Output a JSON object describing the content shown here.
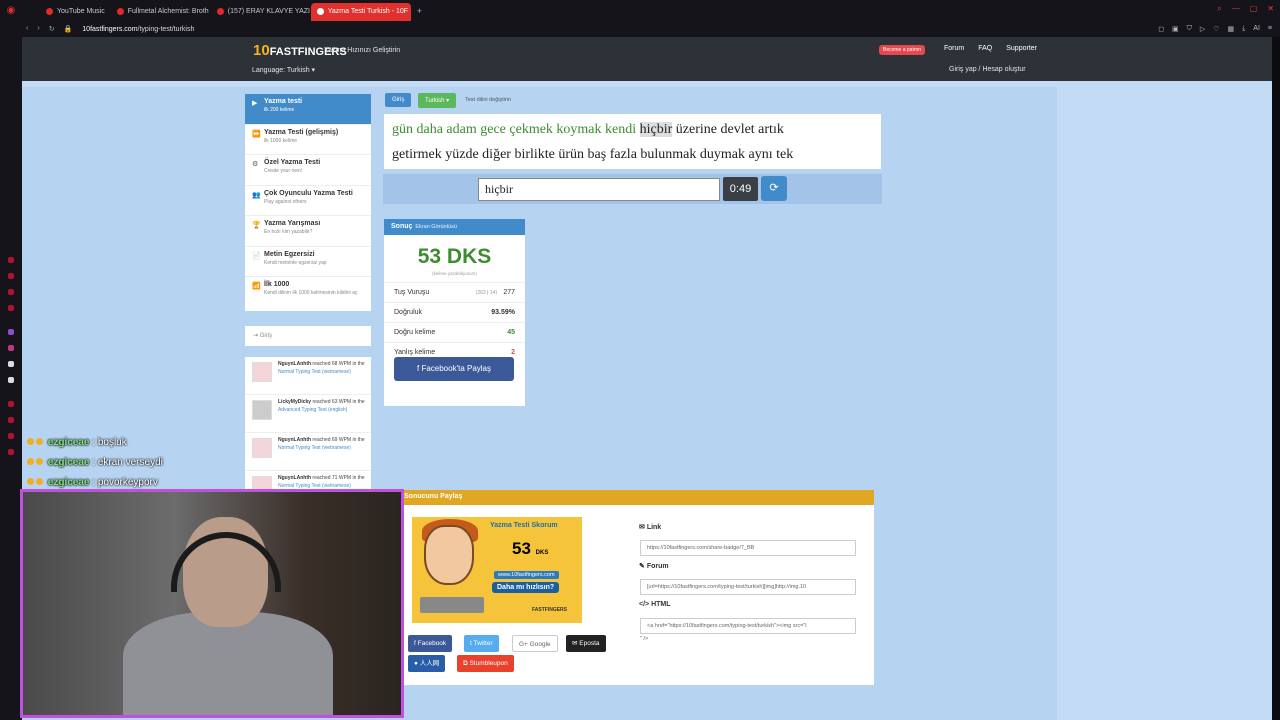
{
  "browser": {
    "tabs": [
      {
        "label": "YouTube Music",
        "color": "#e02b2b"
      },
      {
        "label": "Fullmetal Alchemist: Broth",
        "color": "#e02b2b"
      },
      {
        "label": "(157) ERAY KLAVYE YAZI",
        "color": "#e02b2b"
      },
      {
        "label": "Yazma Testi Turkish - 10F",
        "color": "#ffffff"
      }
    ],
    "url_host": "10fastfingers.com",
    "url_path": "/typing-test/turkish",
    "ai_label": "AI"
  },
  "site": {
    "brand_ten": "10",
    "brand_name": "FASTFINGERS",
    "tagline": "Yazma Hızınızı Geliştirin",
    "language_label": "Language: Turkish ▾",
    "patron": "Become a patron",
    "menu": [
      "Forum",
      "FAQ",
      "Supporter"
    ],
    "login_signup": "Giriş yap / Hesap oluştur"
  },
  "sidemenu": [
    {
      "title": "Yazma testi",
      "sub": "ilk 200 kelime",
      "icon": "▶"
    },
    {
      "title": "Yazma Testi (gelişmiş)",
      "sub": "ilk 1000 kelime",
      "icon": "⏩"
    },
    {
      "title": "Özel Yazma Testi",
      "sub": "Create your own!",
      "icon": "⚙"
    },
    {
      "title": "Çok Oyunculu Yazma Testi",
      "sub": "Play against others",
      "icon": "👥"
    },
    {
      "title": "Yazma Yarışması",
      "sub": "En hızlı kim yazabilir?",
      "icon": "🏆"
    },
    {
      "title": "Metin Egzersizi",
      "sub": "Kendi metninle egzersiz yap",
      "icon": "📄"
    },
    {
      "title": "İlk 1000",
      "sub": "Kendi dilinin ilk 1000 kelimesinin kilidini aç",
      "icon": "📶"
    }
  ],
  "login_box": "Giriş",
  "feed": [
    {
      "user": "NguynLAnhth",
      "pre": " reached 68 WPM in the ",
      "link": "Normal Typing Test (vietnamese)"
    },
    {
      "user": "LickyMyDicky",
      "pre": " reached 63 WPM in the ",
      "link": "Advanced Typing Test (english)"
    },
    {
      "user": "NguynLAnhth",
      "pre": " reached 69 WPM in the ",
      "link": "Normal Typing Test (vietnamese)"
    },
    {
      "user": "NguynLAnhth",
      "pre": " reached 71 WPM in the ",
      "link": "Normal Typing Test (vietnamese)"
    }
  ],
  "typing": {
    "btn_login": "Giriş",
    "btn_lang": "Turkish ▾",
    "change_lang": "Test dilini değiştirin",
    "line1_done": "gün daha adam gece çekmek koymak kendi",
    "line1_current": "hiçbir",
    "line1_rest": "üzerine devlet artık",
    "line2": "getirmek yüzde diğer birlikte ürün baş fazla bulunmak duymak aynı tek",
    "input_value": "hiçbir",
    "timer": "0:49",
    "reload_icon": "⟳"
  },
  "result": {
    "title": "Sonuç",
    "screenshot": "Ekran Görüntüsü",
    "wpm": "53 DKS",
    "wpm_sub": "(kelime yazabiliyorum)",
    "rows": [
      {
        "label": "Tuş Vuruşu",
        "detail": "(263 | 14)",
        "value": "277"
      },
      {
        "label": "Doğruluk",
        "value": "93.59%"
      },
      {
        "label": "Doğru kelime",
        "value": "45"
      },
      {
        "label": "Yanlış kelime",
        "value": "2"
      }
    ],
    "facebook": "Facebook'ta Paylaş"
  },
  "share": {
    "title": "Sonucunu Paylaş",
    "badge_title": "Yazma Testi Skorum",
    "badge_value": "53",
    "badge_unit": "DKS",
    "badge_url": "www.10fastfingers.com",
    "badge_question": "Daha mı hızlısın?",
    "badge_footer": "FASTFINGERS",
    "buttons": [
      "Facebook",
      "Twitter",
      "Google",
      "Eposta",
      "人人网",
      "Stumbleupon"
    ],
    "link_label": "Link",
    "link_value": "https://10fastfingers.com/share-badge/7_BB",
    "forum_label": "Forum",
    "forum_value": "[url=https://10fastfingers.com/typing-test/turkish][img]http://img.10",
    "html_label": "HTML",
    "html_value": "<a href=\"https://10fastfingers.com/typing-test/turkish\"><img src=\"l",
    "html_tail": "\" />"
  },
  "chat": [
    {
      "user": "ezgiceae",
      "msg": " : boşluk"
    },
    {
      "user": "ezgiceae",
      "msg": " : ekran verseydi"
    },
    {
      "user": "ezgiceae",
      "msg": " : povorkeyporv"
    }
  ]
}
